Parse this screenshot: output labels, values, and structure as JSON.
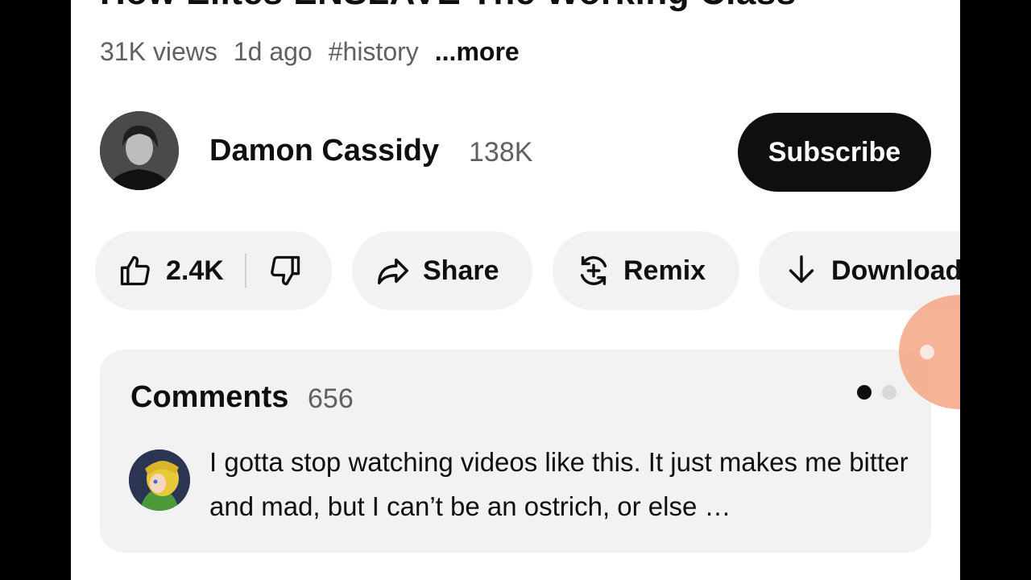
{
  "video": {
    "title": "How Elites ENSLAVE The Working Class",
    "views": "31K views",
    "age": "1d ago",
    "hashtag": "#history",
    "more": "...more"
  },
  "channel": {
    "name": "Damon Cassidy",
    "subscribers": "138K",
    "subscribe_label": "Subscribe"
  },
  "actions": {
    "likes": "2.4K",
    "share": "Share",
    "remix": "Remix",
    "download": "Download"
  },
  "comments": {
    "heading": "Comments",
    "count": "656",
    "preview": "I gotta stop watching videos like this. It just makes me bitter and mad, but I can’t be an ostrich, or else …"
  },
  "colors": {
    "accent": "#0f0f0f",
    "secondary_text": "#606060",
    "pill_bg": "#f2f2f2",
    "touch_indicator": "#f4a07d"
  },
  "icons": [
    "thumbs-up-icon",
    "thumbs-down-icon",
    "share-icon",
    "remix-icon",
    "download-icon"
  ]
}
